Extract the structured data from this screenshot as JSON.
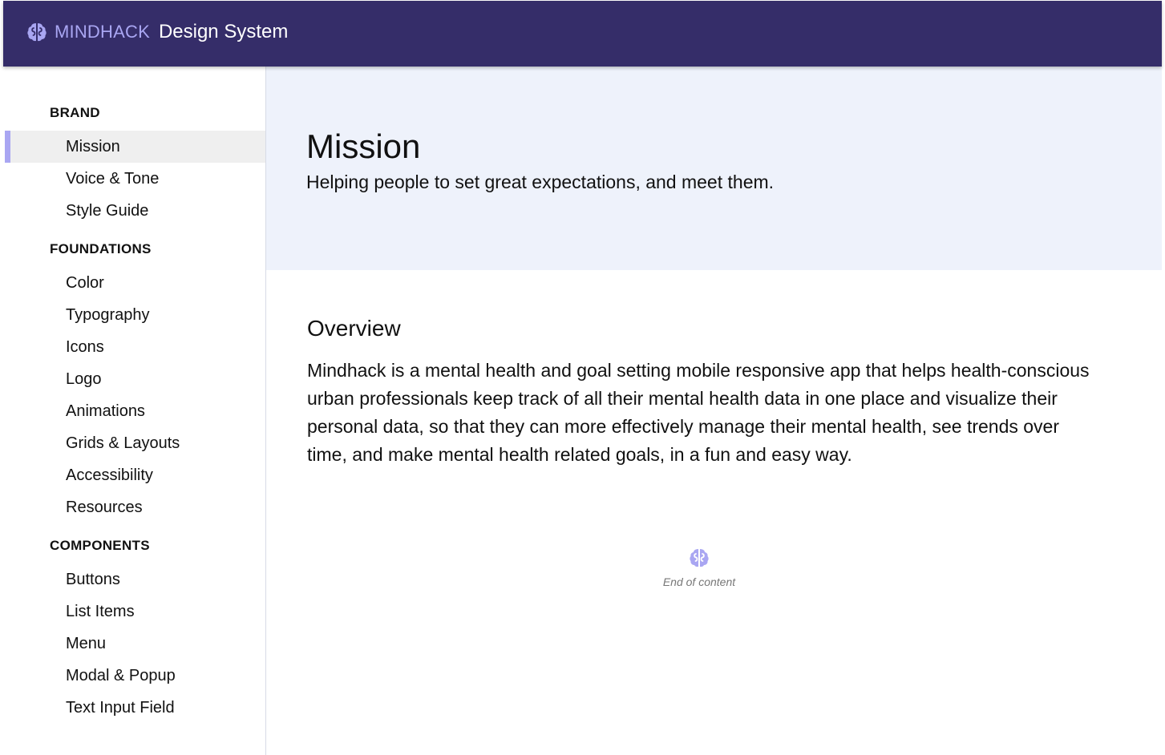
{
  "header": {
    "brand_name": "MINDHACK",
    "brand_sub": "Design System",
    "logo_icon": "brain-icon",
    "logo_color": "#a9a6f2",
    "background": "#352d69"
  },
  "sidebar": {
    "sections": [
      {
        "title": "BRAND",
        "items": [
          {
            "label": "Mission",
            "active": true
          },
          {
            "label": "Voice & Tone"
          },
          {
            "label": "Style Guide"
          }
        ]
      },
      {
        "title": "FOUNDATIONS",
        "items": [
          {
            "label": "Color"
          },
          {
            "label": "Typography"
          },
          {
            "label": "Icons"
          },
          {
            "label": "Logo"
          },
          {
            "label": "Animations"
          },
          {
            "label": "Grids & Layouts"
          },
          {
            "label": "Accessibility"
          },
          {
            "label": "Resources"
          }
        ]
      },
      {
        "title": "COMPONENTS",
        "items": [
          {
            "label": "Buttons"
          },
          {
            "label": "List Items"
          },
          {
            "label": "Menu"
          },
          {
            "label": "Modal & Popup"
          },
          {
            "label": "Text Input Field"
          }
        ]
      }
    ],
    "active_indicator_color": "#a9a6f2"
  },
  "main": {
    "hero": {
      "title": "Mission",
      "subtitle": "Helping people to set great expectations, and meet them."
    },
    "overview": {
      "title": "Overview",
      "body": "Mindhack is a mental health and goal setting mobile responsive app that helps health-conscious urban professionals keep track of all their mental health data in one place and visualize their personal data, so that they can more effectively manage their mental health, see trends over time, and make mental health related goals, in a fun and easy way."
    },
    "end": {
      "icon": "brain-icon",
      "text": "End of content"
    }
  }
}
